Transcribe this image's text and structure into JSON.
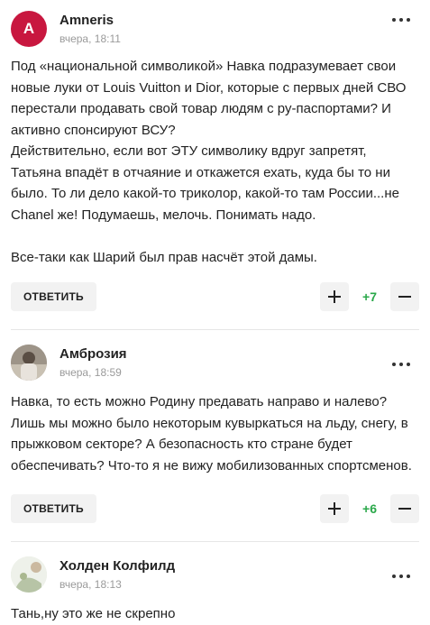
{
  "colors": {
    "accent_red": "#c8173f",
    "score_green": "#2aa84a",
    "button_bg": "#f2f2f2"
  },
  "comments": [
    {
      "author": "Amneris",
      "avatar_letter": "A",
      "date": "вчера, 18:11",
      "lines": [
        "Под «национальной символикой» Навка подразумевает свои новые луки от Louis Vuitton и Dior, которые с первых дней СВО перестали продавать свой товар людям с ру-паспортами? И активно спонсируют ВСУ?",
        "Действительно, если вот ЭТУ символику вдруг запретят, Татьяна впадёт в отчаяние и откажется ехать, куда бы то ни было. То ли дело какой-то триколор, какой-то там России...не Chanel же! Подумаешь, мелочь. Понимать надо.",
        "Все-таки как Шарий был прав насчёт этой дамы."
      ],
      "reply_label": "ОТВЕТИТЬ",
      "score": "+7"
    },
    {
      "author": "Амброзия",
      "date": "вчера, 18:59",
      "lines": [
        "Навка, то есть можно Родину предавать направо и налево? Лишь мы можно было некоторым кувыркаться на льду, снегу, в прыжковом секторе? А безопасность кто стране будет обеспечивать? Что-то я не вижу мобилизованных спортсменов."
      ],
      "reply_label": "ОТВЕТИТЬ",
      "score": "+6"
    },
    {
      "author": "Холден Колфилд",
      "date": "вчера, 18:13",
      "lines": [
        "Тань,ну это же не скрепно"
      ]
    }
  ]
}
